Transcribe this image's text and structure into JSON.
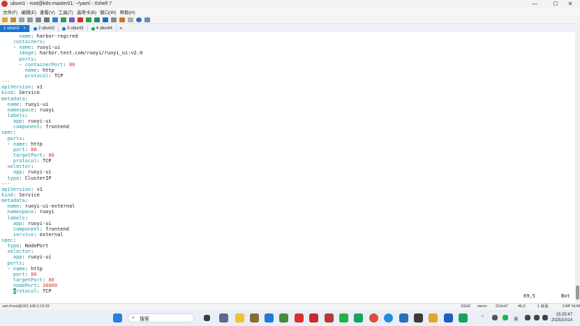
{
  "window": {
    "title": "ubunt1 - root@k8s-master01: ~/yaml - Xshell 7",
    "controls": {
      "minimize": "—",
      "maximize": "☐",
      "close": "✕"
    }
  },
  "menu": [
    "文件(F)",
    "编辑(E)",
    "查看(V)",
    "工具(T)",
    "选项卡(B)",
    "窗口(W)",
    "帮助(H)"
  ],
  "tabs": [
    {
      "label": "1 ubunt1",
      "active": true
    },
    {
      "label": "2 ubunt2",
      "active": false
    },
    {
      "label": "3 ubunt3",
      "active": false
    },
    {
      "label": "4 ubunt4",
      "active": false
    }
  ],
  "terminal": {
    "lines": [
      [
        [
          "v",
          "      "
        ],
        [
          "k",
          "name"
        ],
        [
          "v",
          ": harbor-regcred"
        ]
      ],
      [
        [
          "v",
          "    "
        ],
        [
          "k",
          "containers"
        ],
        [
          "v",
          ":"
        ]
      ],
      [
        [
          "v",
          "    - "
        ],
        [
          "k",
          "name"
        ],
        [
          "v",
          ": ruoyi-ui"
        ]
      ],
      [
        [
          "v",
          "      "
        ],
        [
          "k",
          "image"
        ],
        [
          "v",
          ": harbor.test.com/ruoyi/ruoyi_ui:v2.0"
        ]
      ],
      [
        [
          "v",
          "      "
        ],
        [
          "k",
          "ports"
        ],
        [
          "v",
          ":"
        ]
      ],
      [
        [
          "v",
          "      - "
        ],
        [
          "k",
          "containerPort"
        ],
        [
          "v",
          ": "
        ],
        [
          "n",
          "80"
        ]
      ],
      [
        [
          "v",
          "        "
        ],
        [
          "k",
          "name"
        ],
        [
          "v",
          ": http"
        ]
      ],
      [
        [
          "v",
          "        "
        ],
        [
          "k",
          "protocol"
        ],
        [
          "v",
          ": TCP"
        ]
      ],
      [
        [
          "sep",
          "---"
        ]
      ],
      [
        [
          "k",
          "apiVersion"
        ],
        [
          "v",
          ": v1"
        ]
      ],
      [
        [
          "k",
          "kind"
        ],
        [
          "v",
          ": Service"
        ]
      ],
      [
        [
          "k",
          "metadata"
        ],
        [
          "v",
          ":"
        ]
      ],
      [
        [
          "v",
          "  "
        ],
        [
          "k",
          "name"
        ],
        [
          "v",
          ": ruoyi-ui"
        ]
      ],
      [
        [
          "v",
          "  "
        ],
        [
          "k",
          "namespace"
        ],
        [
          "v",
          ": ruoyi"
        ]
      ],
      [
        [
          "v",
          "  "
        ],
        [
          "k",
          "labels"
        ],
        [
          "v",
          ":"
        ]
      ],
      [
        [
          "v",
          "    "
        ],
        [
          "k",
          "app"
        ],
        [
          "v",
          ": ruoyi-ui"
        ]
      ],
      [
        [
          "v",
          "    "
        ],
        [
          "k",
          "component"
        ],
        [
          "v",
          ": frontend"
        ]
      ],
      [
        [
          "k",
          "spec"
        ],
        [
          "v",
          ":"
        ]
      ],
      [
        [
          "v",
          "  "
        ],
        [
          "k",
          "ports"
        ],
        [
          "v",
          ":"
        ]
      ],
      [
        [
          "v",
          "  - "
        ],
        [
          "k",
          "name"
        ],
        [
          "v",
          ": http"
        ]
      ],
      [
        [
          "v",
          "    "
        ],
        [
          "k",
          "port"
        ],
        [
          "v",
          ": "
        ],
        [
          "n",
          "80"
        ]
      ],
      [
        [
          "v",
          "    "
        ],
        [
          "k",
          "targetPort"
        ],
        [
          "v",
          ": "
        ],
        [
          "n",
          "80"
        ]
      ],
      [
        [
          "v",
          "    "
        ],
        [
          "k",
          "protocol"
        ],
        [
          "v",
          ": TCP"
        ]
      ],
      [
        [
          "v",
          "  "
        ],
        [
          "k",
          "selector"
        ],
        [
          "v",
          ":"
        ]
      ],
      [
        [
          "v",
          "    "
        ],
        [
          "k",
          "app"
        ],
        [
          "v",
          ": ruoyi-ui"
        ]
      ],
      [
        [
          "v",
          "  "
        ],
        [
          "k",
          "type"
        ],
        [
          "v",
          ": ClusterIP"
        ]
      ],
      [
        [
          "sep",
          "---"
        ]
      ],
      [
        [
          "k",
          "apiVersion"
        ],
        [
          "v",
          ": v1"
        ]
      ],
      [
        [
          "k",
          "kind"
        ],
        [
          "v",
          ": Service"
        ]
      ],
      [
        [
          "k",
          "metadata"
        ],
        [
          "v",
          ":"
        ]
      ],
      [
        [
          "v",
          "  "
        ],
        [
          "k",
          "name"
        ],
        [
          "v",
          ": ruoyi-ui-external"
        ]
      ],
      [
        [
          "v",
          "  "
        ],
        [
          "k",
          "namespace"
        ],
        [
          "v",
          ": ruoyi"
        ]
      ],
      [
        [
          "v",
          "  "
        ],
        [
          "k",
          "labels"
        ],
        [
          "v",
          ":"
        ]
      ],
      [
        [
          "v",
          "    "
        ],
        [
          "k",
          "app"
        ],
        [
          "v",
          ": ruoyi-ui"
        ]
      ],
      [
        [
          "v",
          "    "
        ],
        [
          "k",
          "component"
        ],
        [
          "v",
          ": frontend"
        ]
      ],
      [
        [
          "v",
          "    "
        ],
        [
          "k",
          "service"
        ],
        [
          "v",
          ": external"
        ]
      ],
      [
        [
          "k",
          "spec"
        ],
        [
          "v",
          ":"
        ]
      ],
      [
        [
          "v",
          "  "
        ],
        [
          "k",
          "type"
        ],
        [
          "v",
          ": NodePort"
        ]
      ],
      [
        [
          "v",
          "  "
        ],
        [
          "k",
          "selector"
        ],
        [
          "v",
          ":"
        ]
      ],
      [
        [
          "v",
          "    "
        ],
        [
          "k",
          "app"
        ],
        [
          "v",
          ": ruoyi-ui"
        ]
      ],
      [
        [
          "v",
          "  "
        ],
        [
          "k",
          "ports"
        ],
        [
          "v",
          ":"
        ]
      ],
      [
        [
          "v",
          "  - "
        ],
        [
          "k",
          "name"
        ],
        [
          "v",
          ": http"
        ]
      ],
      [
        [
          "v",
          "    "
        ],
        [
          "k",
          "port"
        ],
        [
          "v",
          ": "
        ],
        [
          "n",
          "80"
        ]
      ],
      [
        [
          "v",
          "    "
        ],
        [
          "k",
          "targetPort"
        ],
        [
          "v",
          ": "
        ],
        [
          "n",
          "80"
        ]
      ],
      [
        [
          "v",
          "    "
        ],
        [
          "k",
          "nodePort"
        ],
        [
          "v",
          ": "
        ],
        [
          "n",
          "30000"
        ]
      ],
      [
        [
          "v",
          "    "
        ],
        [
          "cursor",
          "p"
        ],
        [
          "k",
          "rotocol"
        ],
        [
          "v",
          ": TCP"
        ]
      ]
    ],
    "cursor_position": "69,5",
    "scroll_position": "Bot"
  },
  "statusbar": {
    "connection": "ssh://root@192.168.0.10:22",
    "protocol": "SSH2",
    "terminal_type": "xterm",
    "size": "210x47",
    "cursor": "46,5",
    "sessions": "1 会话",
    "caps": "CAP",
    "num": "NUM"
  },
  "taskbar": {
    "search_placeholder": "搜索",
    "ime": "英",
    "time": "15:25:47",
    "date": "2025/10/14"
  },
  "colors": {
    "key": "#1a9aa8",
    "number": "#d43a2a",
    "active_tab": "#1a74d3"
  }
}
